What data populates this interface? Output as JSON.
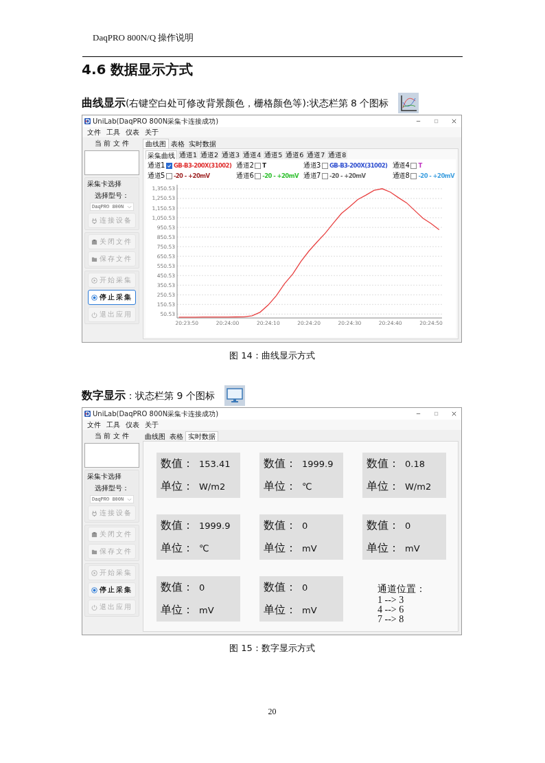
{
  "header": "DaqPRO 800N/Q  操作说明",
  "heading": "4.6 数据显示方式",
  "sections": [
    {
      "intro": "**曲线显示**(右键空白处可修改背景颜色，栅格颜色等):状态栏第 8 个图标",
      "window": {
        "title": "UniLab(DaqPRO 800N采集卡连接成功)",
        "menu": [
          "文件",
          "工具",
          "仪表",
          "关于"
        ],
        "sidebar": {
          "file_label": "当 前 文 件",
          "card_label": "采集卡选择",
          "model_label": "选择型号：",
          "model_value": "DaqPRO 800N",
          "buttons": [
            {
              "kind": "connect",
              "label": "连接设备",
              "disabled": true,
              "focused": false
            },
            {
              "kind": "close_file",
              "label": "关闭文件",
              "disabled": true,
              "focused": false
            },
            {
              "kind": "save_file",
              "label": "保存文件",
              "disabled": true,
              "focused": false
            },
            {
              "kind": "start",
              "label": "开始采集",
              "disabled": true,
              "focused": false
            },
            {
              "kind": "stop",
              "label": "停止采集",
              "disabled": false,
              "focused": true
            },
            {
              "kind": "exit",
              "label": "退出应用",
              "disabled": true,
              "focused": false
            }
          ]
        },
        "tabs": [
          {
            "label": "曲线图",
            "selected": true
          },
          {
            "label": "表格",
            "selected": false
          },
          {
            "label": "实时数据",
            "selected": false
          }
        ],
        "subtabs": [
          {
            "label": "采集曲线",
            "selected": true
          },
          {
            "label": "通道1",
            "selected": false
          },
          {
            "label": "通道2",
            "selected": false
          },
          {
            "label": "通道3",
            "selected": false
          },
          {
            "label": "通道4",
            "selected": false
          },
          {
            "label": "通道5",
            "selected": false
          },
          {
            "label": "通道6",
            "selected": false
          },
          {
            "label": "通道7",
            "selected": false
          },
          {
            "label": "通道8",
            "selected": false
          }
        ],
        "channels": [
          {
            "name": "通道1",
            "checked": true,
            "sensor": "GB-B3-200X(31002)",
            "color": "#e03030"
          },
          {
            "name": "通道2",
            "checked": false,
            "sensor": "T",
            "color": "#202020"
          },
          {
            "name": "通道3",
            "checked": false,
            "sensor": "GB-B3-200X(31002)",
            "color": "#3050d0"
          },
          {
            "name": "通道4",
            "checked": false,
            "sensor": "T",
            "color": "#c030c0"
          },
          {
            "name": "通道5",
            "checked": false,
            "sensor": "-20 - +20mV",
            "color": "#a02828"
          },
          {
            "name": "通道6",
            "checked": false,
            "sensor": "-20 - +20mV",
            "color": "#30c030"
          },
          {
            "name": "通道7",
            "checked": false,
            "sensor": "-20 - +20mV",
            "color": "#606060"
          },
          {
            "name": "通道8",
            "checked": false,
            "sensor": "-20 - +20mV",
            "color": "#40a0e0"
          }
        ],
        "chart_data": {
          "type": "line",
          "categories": [
            null,
            "20:23:50",
            null,
            null,
            null,
            null,
            "20:24:00",
            null,
            null,
            null,
            null,
            "20:24:10",
            null,
            null,
            null,
            null,
            "20:24:20",
            null,
            null,
            null,
            null,
            "20:24:30",
            null,
            null,
            null,
            null,
            "20:24:40",
            null,
            null,
            null,
            null,
            "20:24:50",
            null
          ],
          "series": [
            {
              "color": "#e84040",
              "values": [
                18,
                18,
                18,
                19,
                19,
                20,
                20,
                21,
                22,
                33,
                70,
                145,
                243,
                365,
                465,
                595,
                705,
                800,
                890,
                995,
                1095,
                1165,
                1240,
                1285,
                1335,
                1352,
                1317,
                1258,
                1205,
                1125,
                1045,
                990,
                925
              ]
            }
          ],
          "ylim": [
            10,
            1393
          ],
          "grid": true,
          "yticks": [
            {
              "value": 50.53,
              "label": "50.53"
            },
            {
              "value": 150.53,
              "label": "150.53"
            },
            {
              "value": 250.53,
              "label": "250.53"
            },
            {
              "value": 350.53,
              "label": "350.53"
            },
            {
              "value": 450.53,
              "label": "450.53"
            },
            {
              "value": 550.53,
              "label": "550.53"
            },
            {
              "value": 650.53,
              "label": "650.53"
            },
            {
              "value": 750.53,
              "label": "750.53"
            },
            {
              "value": 850.53,
              "label": "850.53"
            },
            {
              "value": 950.53,
              "label": "950.53"
            },
            {
              "value": 1050.53,
              "label": "1,050.53"
            },
            {
              "value": 1150.53,
              "label": "1,150.53"
            },
            {
              "value": 1250.53,
              "label": "1,250.53"
            },
            {
              "value": 1350.53,
              "label": "1,350.53"
            }
          ]
        }
      },
      "caption": "图 14：曲线显示方式"
    },
    {
      "intro": "**数字显示**：状态栏第 9 个图标",
      "window": {
        "title": "UniLab(DaqPRO 800N采集卡连接成功)",
        "menu": [
          "文件",
          "工具",
          "仪表",
          "关于"
        ],
        "sidebar": {
          "file_label": "当 前 文 件",
          "card_label": "采集卡选择",
          "model_label": "选择型号：",
          "model_value": "DaqPRO 800N",
          "buttons": [
            {
              "kind": "connect",
              "label": "连接设备",
              "disabled": true,
              "focused": false
            },
            {
              "kind": "close_file",
              "label": "关闭文件",
              "disabled": true,
              "focused": false
            },
            {
              "kind": "save_file",
              "label": "保存文件",
              "disabled": true,
              "focused": false
            },
            {
              "kind": "start",
              "label": "开始采集",
              "disabled": true,
              "focused": false
            },
            {
              "kind": "stop",
              "label": "停止采集",
              "disabled": false,
              "focused": false
            },
            {
              "kind": "exit",
              "label": "退出应用",
              "disabled": true,
              "focused": false
            }
          ]
        },
        "tabs": [
          {
            "label": "曲线图",
            "selected": false
          },
          {
            "label": "表格",
            "selected": false
          },
          {
            "label": "实时数据",
            "selected": true
          }
        ],
        "cards": [
          {
            "value_label": "数值：",
            "value": "153.41",
            "unit_label": "单位：",
            "unit": "W/m2"
          },
          {
            "value_label": "数值：",
            "value": "1999.9",
            "unit_label": "单位：",
            "unit": "℃"
          },
          {
            "value_label": "数值：",
            "value": "0.18",
            "unit_label": "单位：",
            "unit": "W/m2"
          },
          {
            "value_label": "数值：",
            "value": "1999.9",
            "unit_label": "单位：",
            "unit": "℃"
          },
          {
            "value_label": "数值：",
            "value": "0",
            "unit_label": "单位：",
            "unit": "mV"
          },
          {
            "value_label": "数值：",
            "value": "0",
            "unit_label": "单位：",
            "unit": "mV"
          },
          {
            "value_label": "数值：",
            "value": "0",
            "unit_label": "单位：",
            "unit": "mV"
          },
          {
            "value_label": "数值：",
            "value": "0",
            "unit_label": "单位：",
            "unit": "mV"
          }
        ],
        "note": {
          "title": "通道位置：",
          "lines": [
            "1 --> 3",
            "4 --> 6",
            "7 --> 8"
          ]
        }
      },
      "caption": "图 15：数字显示方式"
    }
  ],
  "page_number": "20"
}
